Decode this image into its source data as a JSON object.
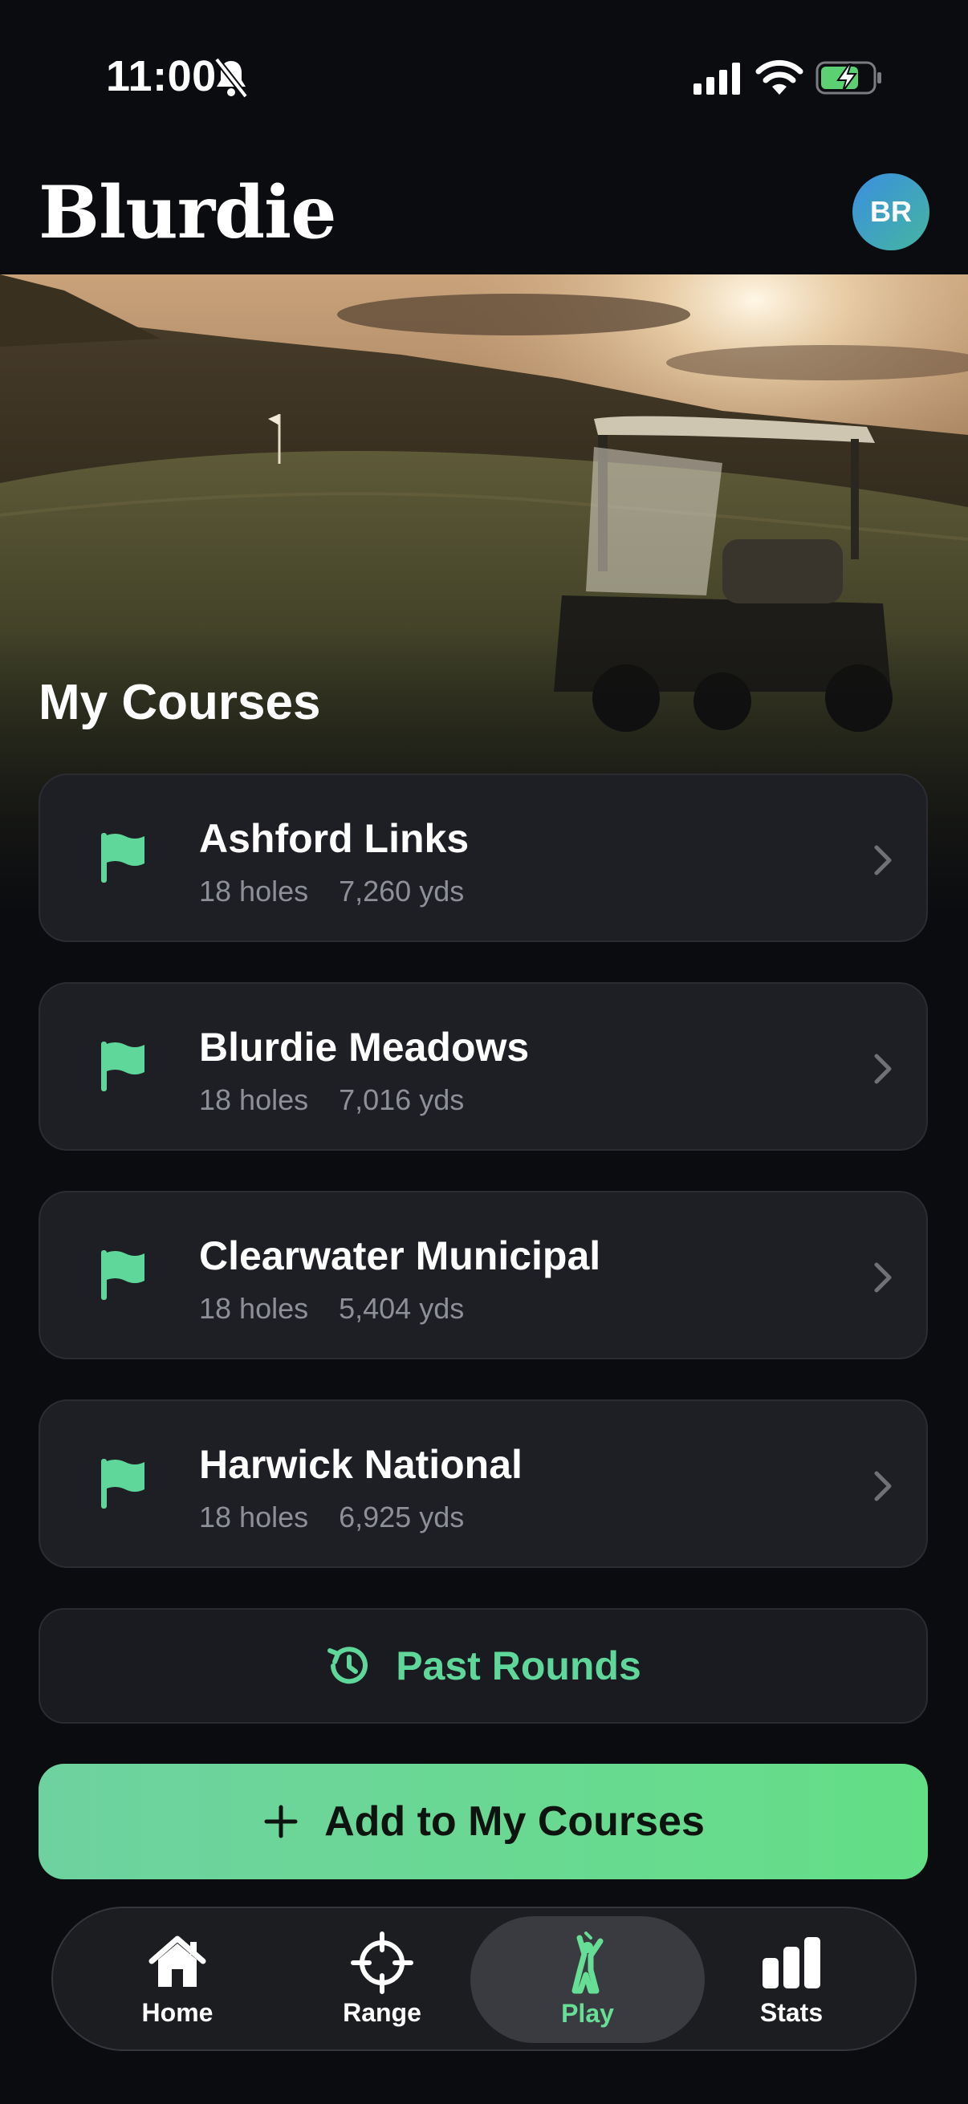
{
  "status_bar": {
    "time": "11:00"
  },
  "header": {
    "brand": "Blurdie",
    "avatar_initials": "BR"
  },
  "section_title": "My Courses",
  "courses": [
    {
      "name": "Ashford Links",
      "holes": "18 holes",
      "yards": "7,260 yds"
    },
    {
      "name": "Blurdie Meadows",
      "holes": "18 holes",
      "yards": "7,016 yds"
    },
    {
      "name": "Clearwater Municipal",
      "holes": "18 holes",
      "yards": "5,404 yds"
    },
    {
      "name": "Harwick National",
      "holes": "18 holes",
      "yards": "6,925 yds"
    }
  ],
  "past_rounds_label": "Past Rounds",
  "add_button_label": "Add to My Courses",
  "tabs": [
    {
      "label": "Home",
      "icon": "home-icon"
    },
    {
      "label": "Range",
      "icon": "crosshair-icon"
    },
    {
      "label": "Play",
      "icon": "golfer-icon",
      "active": true
    },
    {
      "label": "Stats",
      "icon": "bar-chart-icon"
    }
  ],
  "colors": {
    "accent": "#66de95",
    "card": "#1e1f24",
    "background": "#0b0c10"
  }
}
